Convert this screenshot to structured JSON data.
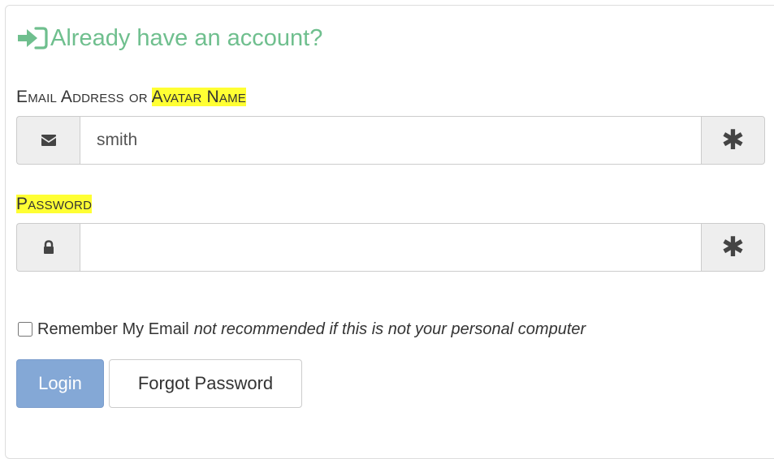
{
  "heading": {
    "text": "Already have an account?",
    "icon": "sign-in-icon",
    "color": "#6fbf8e"
  },
  "email_field": {
    "label_part1": "Email Address or ",
    "label_part2": "Avatar Name",
    "value": "smith",
    "placeholder": "",
    "left_icon": "envelope-icon",
    "right_icon": "asterisk-icon",
    "right_symbol": "✱"
  },
  "password_field": {
    "label": "Password",
    "value": "",
    "left_icon": "lock-icon",
    "right_icon": "asterisk-icon",
    "right_symbol": "✱"
  },
  "remember": {
    "label": "Remember My Email",
    "note": "not recommended if this is not your personal computer",
    "checked": false
  },
  "buttons": {
    "login": "Login",
    "forgot": "Forgot Password"
  },
  "colors": {
    "highlight": "#ffff33",
    "login_button": "#84a8d6"
  }
}
